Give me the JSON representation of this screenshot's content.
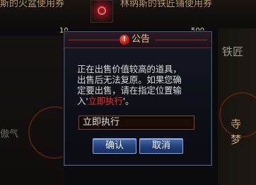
{
  "background": {
    "item_left_name": "斯的火盆使用券",
    "item_right_name": "林纳斯的铁匠铺使用券",
    "item_left_count": "10",
    "item_right_count": "500",
    "right_label_1": "铁匠",
    "right_label_2": "寺",
    "right_label_3": "梦",
    "left_label": "傲气"
  },
  "dialog": {
    "title": "公告",
    "alert_icon_glyph": "!",
    "message_line_1": "正在出售价值较高的道具，",
    "message_line_2": "出售后无法复原。如果您确",
    "message_line_3": "定要出售，请在指定位置输",
    "message_line_4_prefix": "入'",
    "message_line_4_highlight": "立即执行",
    "message_line_4_suffix": "'。",
    "input_value": "立即执行",
    "confirm_label": "确认",
    "cancel_label": "取消"
  },
  "colors": {
    "highlight": "#ff2a2a",
    "title": "#e8c890",
    "button_blue": "#22407a"
  }
}
